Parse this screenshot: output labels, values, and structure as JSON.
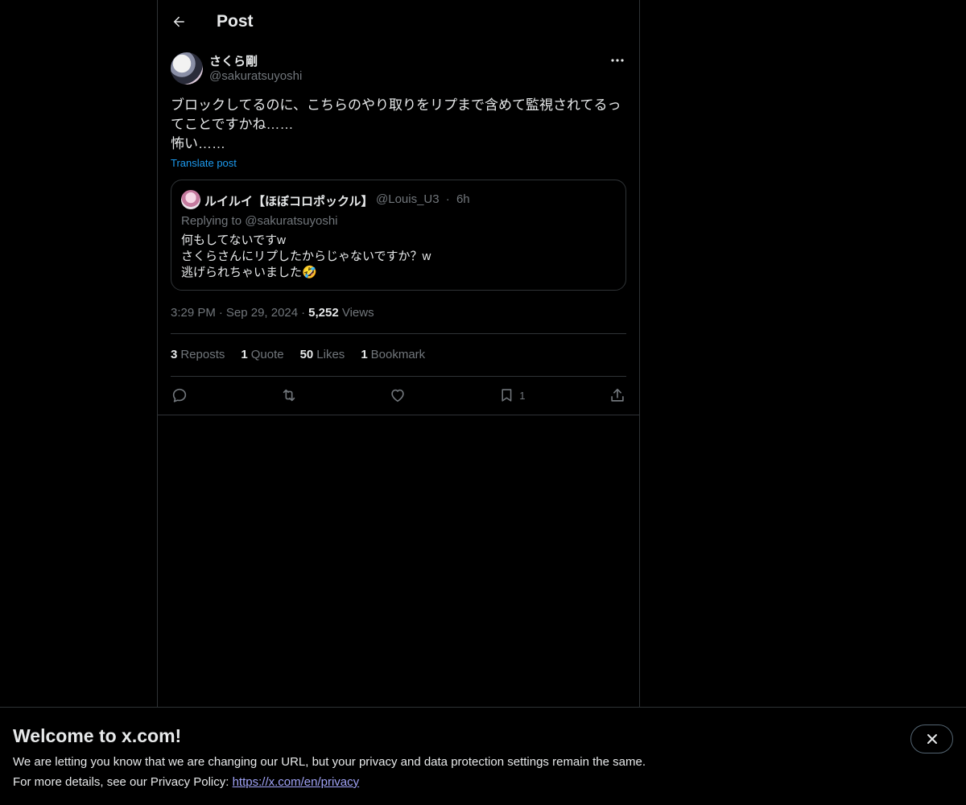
{
  "header": {
    "title": "Post"
  },
  "post": {
    "author_name": "さくら剛",
    "author_handle": "@sakuratsuyoshi",
    "text": "ブロックしてるのに、こちらのやり取りをリプまで含めて監視されてるってことですかね……\n怖い……",
    "translate_label": "Translate post",
    "time": "3:29 PM",
    "date": "Sep 29, 2024",
    "views_count": "5,252",
    "views_label": "Views"
  },
  "quote": {
    "name": "ルイルイ【ほぼコロポックル】",
    "handle": "@Louis_U3",
    "age": "6h",
    "replying": "Replying to @sakuratsuyoshi",
    "text": "何もしてないですw\nさくらさんにリプしたからじゃないですか？w\n逃げられちゃいました🤣"
  },
  "stats": [
    {
      "count": "3",
      "label": "Reposts"
    },
    {
      "count": "1",
      "label": "Quote"
    },
    {
      "count": "50",
      "label": "Likes"
    },
    {
      "count": "1",
      "label": "Bookmark"
    }
  ],
  "actions": {
    "bookmark_count": "1"
  },
  "banner": {
    "title": "Welcome to x.com!",
    "line1": "We are letting you know that we are changing our URL, but your privacy and data protection settings remain the same.",
    "line2_prefix": "For more details, see our Privacy Policy: ",
    "link": "https://x.com/en/privacy"
  },
  "colors": {
    "background": "#000000",
    "text": "#e7e9ea",
    "muted": "#71767b",
    "accent": "#1d9bf0",
    "border": "#2f3336"
  }
}
